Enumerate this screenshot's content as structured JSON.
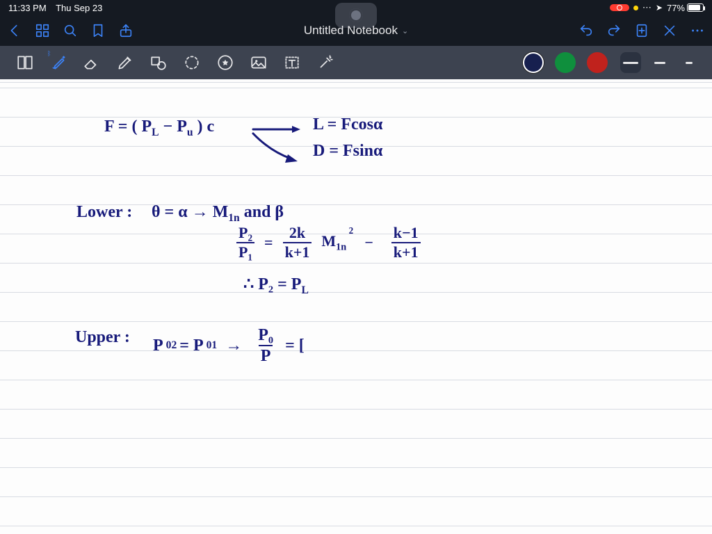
{
  "status": {
    "time": "11:33 PM",
    "date": "Thu Sep 23",
    "battery_pct": "77%",
    "loc_glyph": "➤"
  },
  "title": "Untitled Notebook",
  "colors": {
    "c1": "#17204f",
    "c2": "#0f8f3d",
    "c3": "#c0221d"
  },
  "stroke_widths": {
    "w1": 22,
    "w2": 16,
    "w3": 10
  },
  "notes": {
    "l1a": "F = ( P",
    "l1a_sub": "L",
    "l1b": " − P",
    "l1b_sub": "u",
    "l1c": " ) c",
    "l1r1": "L = Fcosα",
    "l1r2": "D = Fsinα",
    "l2_label": "Lower :",
    "l2a": "θ = α  →  M",
    "l2a_sub": "1n",
    "l2b": "  and  β",
    "l3_lhs_n": "P₂",
    "l3_lhs_d": "P₁",
    "l3_eq": "=",
    "l3_t1_n": "2k",
    "l3_t1_d": "k+1",
    "l3_m": "M",
    "l3_m_sub": "1n",
    "l3_m_sup": "2",
    "l3_minus": "−",
    "l3_t2_n": "k−1",
    "l3_t2_d": "k+1",
    "l4_th": "∴  P₂ = P",
    "l4_th_sub": "L",
    "l5_label": "Upper :",
    "l5a": "P",
    "l5a_s1": "02",
    "l5eq1": " = P",
    "l5a_s2": "01",
    "l5arrow": "  →  ",
    "l5_frac_n": "P₀",
    "l5_frac_d": "P",
    "l5_eq2": " = [",
    "l5_tail": ""
  }
}
